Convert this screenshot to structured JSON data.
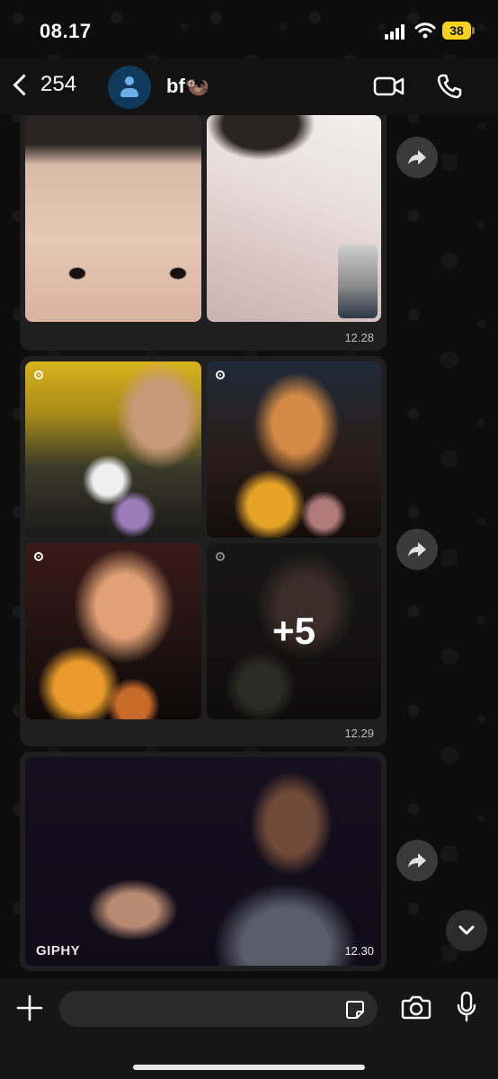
{
  "status_bar": {
    "time": "08.17",
    "battery": "38",
    "icons": [
      "signal-icon",
      "wifi-icon",
      "battery-icon"
    ]
  },
  "header": {
    "back_count": "254",
    "contact_name": "bf🦦",
    "icons": [
      "back-chevron-icon",
      "avatar-person-icon",
      "video-call-icon",
      "voice-call-icon"
    ]
  },
  "messages": [
    {
      "type": "photo-album",
      "photos": [
        "selfie-face-photo",
        "cat-video-call-photo"
      ],
      "time": "12.28"
    },
    {
      "type": "photo-album",
      "photos": [
        "flowers-selfie-1",
        "flowers-selfie-2",
        "flowers-selfie-3",
        "flowers-selfie-4"
      ],
      "more_count": "+5",
      "time": "12.29"
    },
    {
      "type": "gif",
      "provider": "GIPHY",
      "time": "12.30"
    }
  ],
  "input": {
    "placeholder": "",
    "icons": [
      "plus-icon",
      "sticker-icon",
      "camera-icon",
      "mic-icon"
    ]
  },
  "colors": {
    "background": "#0b0b0b",
    "header": "#121212",
    "bubble": "#1f1f1f",
    "battery": "#f5d21f",
    "avatar": "#103a5c"
  }
}
